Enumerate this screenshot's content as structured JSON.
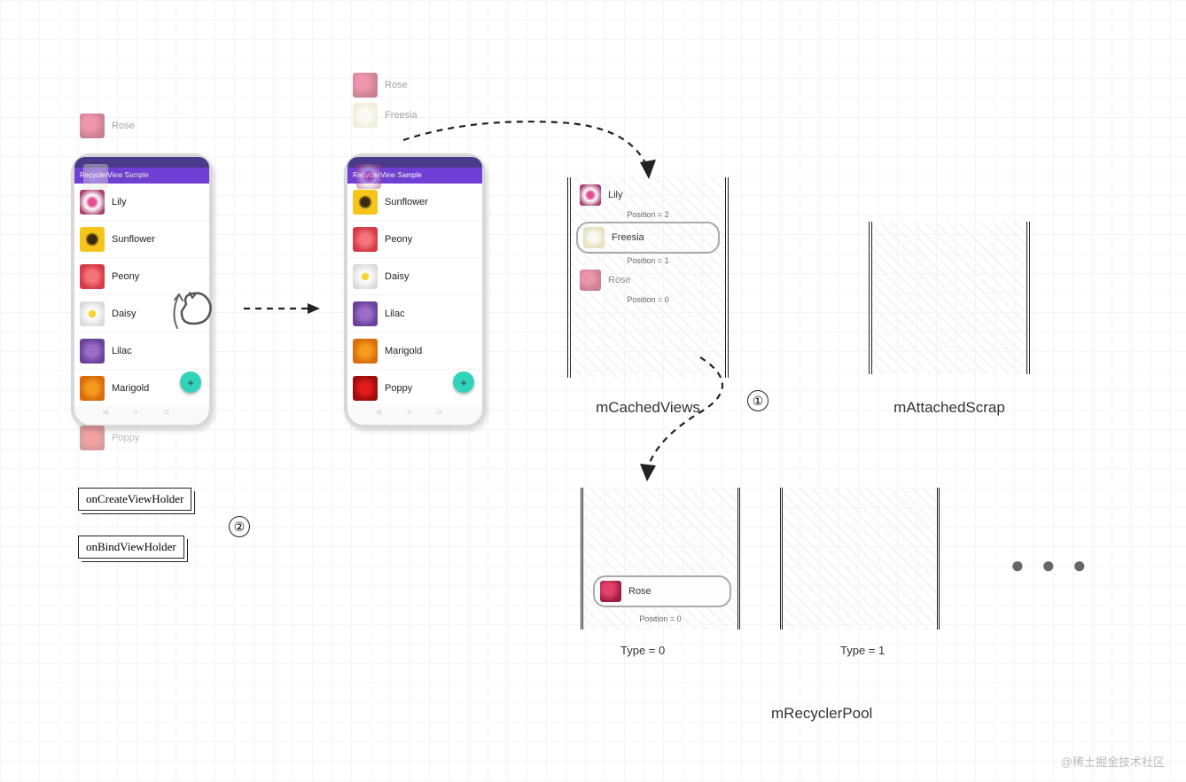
{
  "app": {
    "title": "RecyclerView Sample"
  },
  "flowers": {
    "rose": "Rose",
    "freesia": "Freesia",
    "lily": "Lily",
    "sunflower": "Sunflower",
    "peony": "Peony",
    "daisy": "Daisy",
    "lilac": "Lilac",
    "marigold": "Marigold",
    "poppy": "Poppy"
  },
  "phone1": {
    "peek": [
      "rose",
      "freesia"
    ],
    "visible": [
      "lily",
      "sunflower",
      "peony",
      "daisy",
      "lilac",
      "marigold"
    ],
    "below": [
      "poppy"
    ]
  },
  "phone2": {
    "peek": [
      "rose",
      "freesia",
      "lily"
    ],
    "visible": [
      "sunflower",
      "peony",
      "daisy",
      "lilac",
      "marigold",
      "poppy"
    ]
  },
  "cache": {
    "mCachedViews": {
      "label": "mCachedViews",
      "items": [
        {
          "flower": "lily",
          "pos": "Position = 2",
          "highlight": false
        },
        {
          "flower": "freesia",
          "pos": "Position = 1",
          "highlight": true
        },
        {
          "flower": "rose",
          "pos": "Position = 0",
          "highlight": false
        }
      ]
    },
    "mAttachedScrap": {
      "label": "mAttachedScrap"
    },
    "pool": {
      "label": "mRecyclerPool",
      "type0": {
        "label": "Type = 0",
        "item": {
          "flower": "rose",
          "pos": "Position = 0"
        }
      },
      "type1": {
        "label": "Type = 1"
      }
    }
  },
  "callouts": {
    "onCreate": "onCreateViewHolder",
    "onBind": "onBindViewHolder"
  },
  "markers": {
    "one": "①",
    "two": "②"
  },
  "fab": "+",
  "ellipsis": "● ● ●",
  "watermark": "@稀土掘金技术社区"
}
